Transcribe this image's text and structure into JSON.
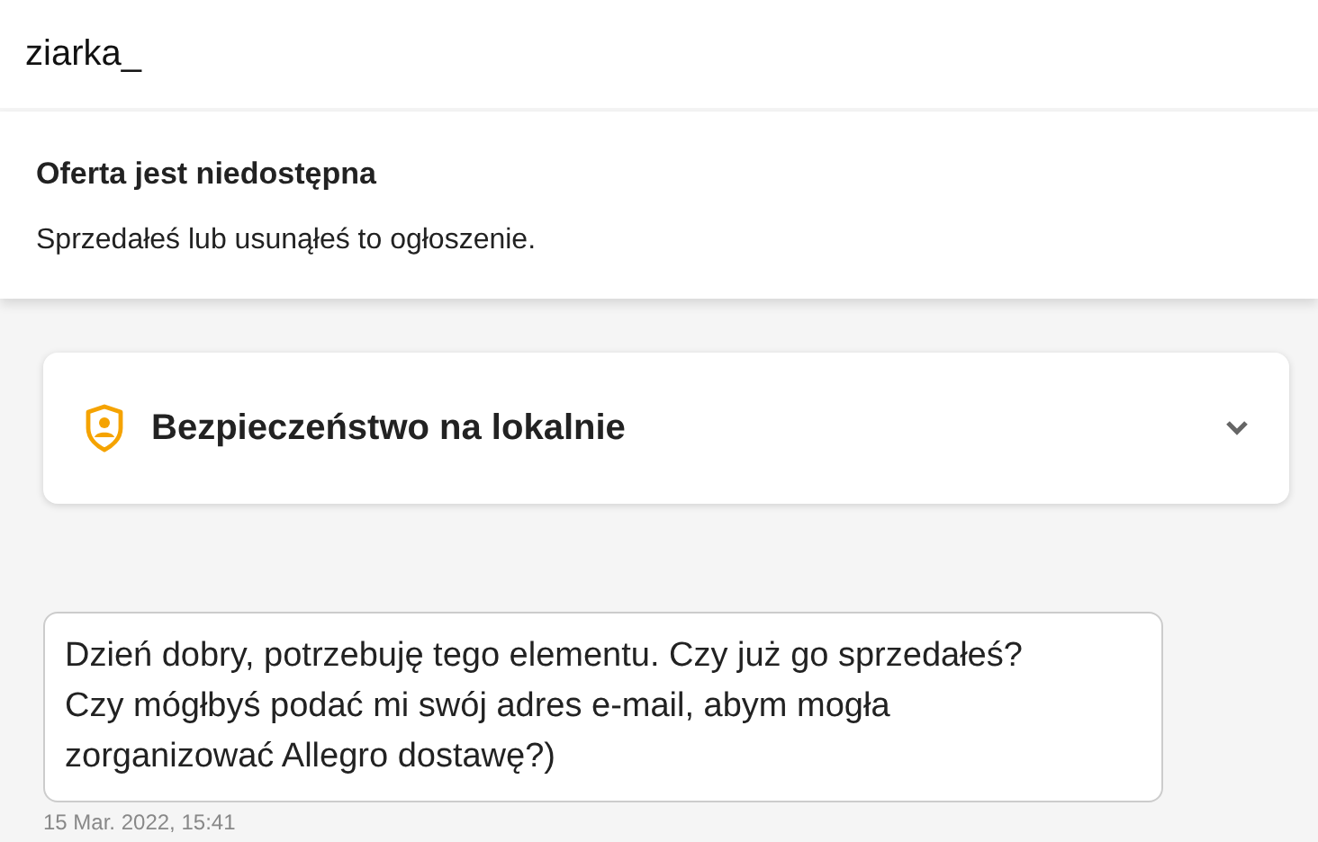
{
  "header": {
    "title": "ziarka_"
  },
  "notice": {
    "title": "Oferta jest niedostępna",
    "text": "Sprzedałeś lub usunąłeś to ogłoszenie."
  },
  "accordion": {
    "title": "Bezpieczeństwo na lokalnie",
    "expanded": false
  },
  "messages": [
    {
      "lines": [
        "Dzień dobry, potrzebuję tego elementu. Czy już go sprzedałeś?",
        "Czy mógłbyś podać mi swój adres e-mail, abym mogła",
        "zorganizować Allegro dostawę?)"
      ],
      "time": "15 Mar. 2022, 15:41"
    }
  ]
}
